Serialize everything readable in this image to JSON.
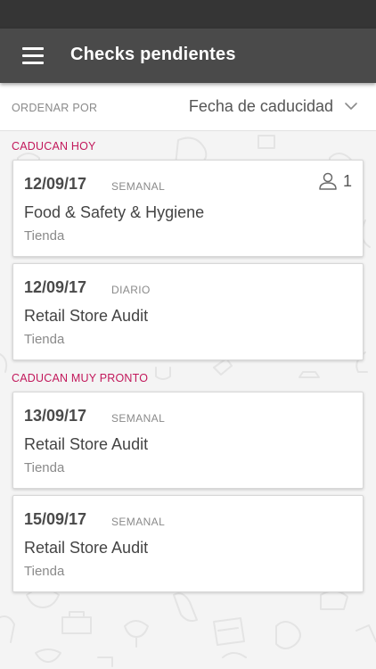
{
  "app_bar": {
    "title": "Checks pendientes",
    "menu_icon": "hamburger-menu-icon",
    "background": "#4a4a4a"
  },
  "sort": {
    "label": "ORDENAR POR",
    "value": "Fecha de caducidad",
    "icon": "chevron-down-icon"
  },
  "accent_color": "#c2185b",
  "sections": [
    {
      "header": "CADUCAN HOY",
      "cards": [
        {
          "date": "12/09/17",
          "frequency": "SEMANAL",
          "title": "Food & Safety & Hygiene",
          "location": "Tienda",
          "assignee_icon": "user-icon",
          "assignee_count": "1"
        },
        {
          "date": "12/09/17",
          "frequency": "DIARIO",
          "title": "Retail Store Audit",
          "location": "Tienda"
        }
      ]
    },
    {
      "header": "CADUCAN MUY PRONTO",
      "cards": [
        {
          "date": "13/09/17",
          "frequency": "SEMANAL",
          "title": "Retail Store Audit",
          "location": "Tienda"
        },
        {
          "date": "15/09/17",
          "frequency": "SEMANAL",
          "title": "Retail Store Audit",
          "location": "Tienda"
        }
      ]
    }
  ]
}
